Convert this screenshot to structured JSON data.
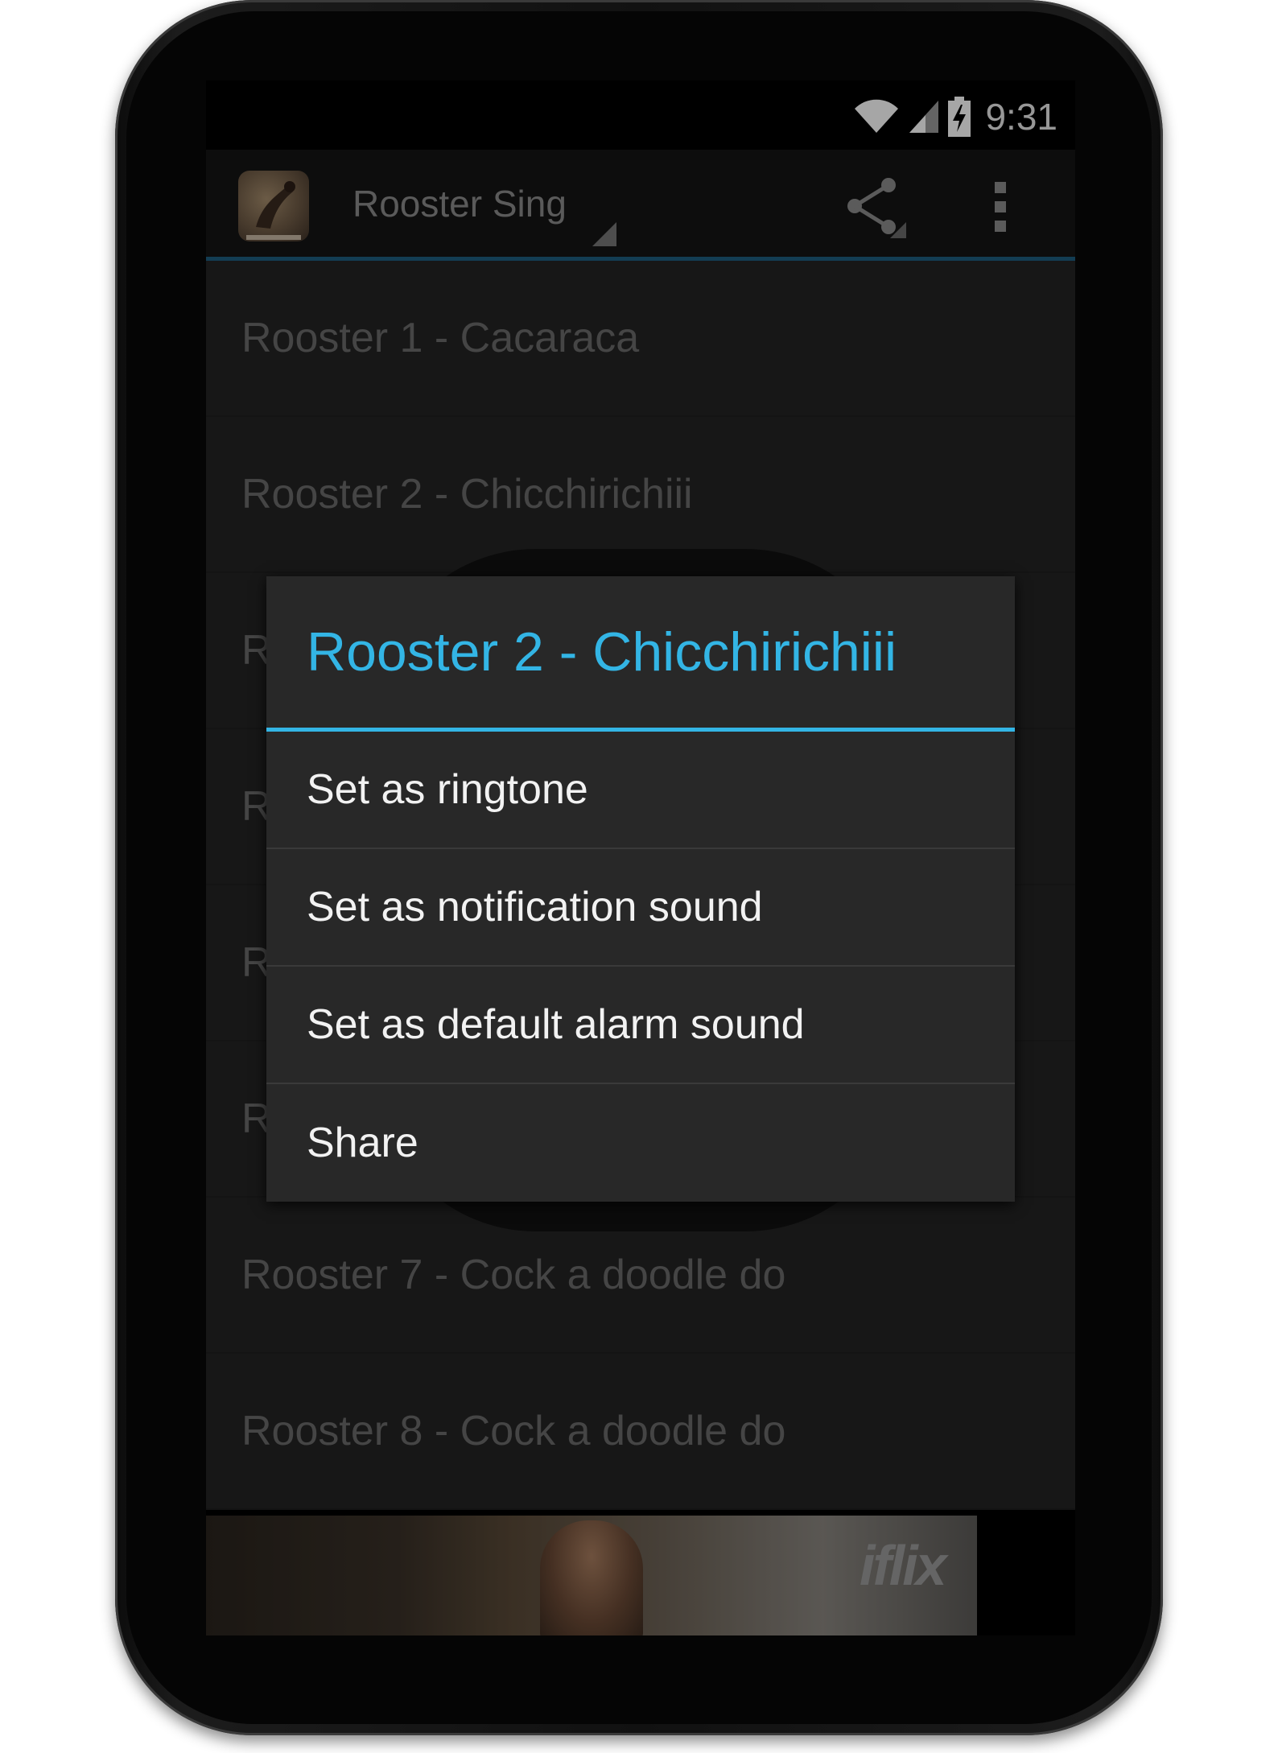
{
  "status_bar": {
    "time": "9:31",
    "icons": [
      "wifi-icon",
      "signal-icon",
      "battery-charging-icon"
    ]
  },
  "action_bar": {
    "title": "Rooster Sing",
    "icons": [
      "app-icon",
      "share-icon",
      "overflow-menu-icon"
    ]
  },
  "list": {
    "items": [
      "Rooster 1 - Cacaraca",
      "Rooster 2 - Chicchirichiii",
      "R",
      "R",
      "R",
      "R",
      "Rooster 7 - Cock a doodle do",
      "Rooster 8 - Cock a doodle do"
    ]
  },
  "ad": {
    "logo_text": "iflix"
  },
  "dialog": {
    "title": "Rooster 2 - Chicchirichiii",
    "items": [
      "Set as ringtone",
      "Set as notification sound",
      "Set as default alarm sound",
      "Share"
    ]
  },
  "colors": {
    "accent": "#33b5e5",
    "actionbar_underline": "#1e5f80",
    "list_bg": "#242424",
    "dialog_bg": "#282828"
  }
}
